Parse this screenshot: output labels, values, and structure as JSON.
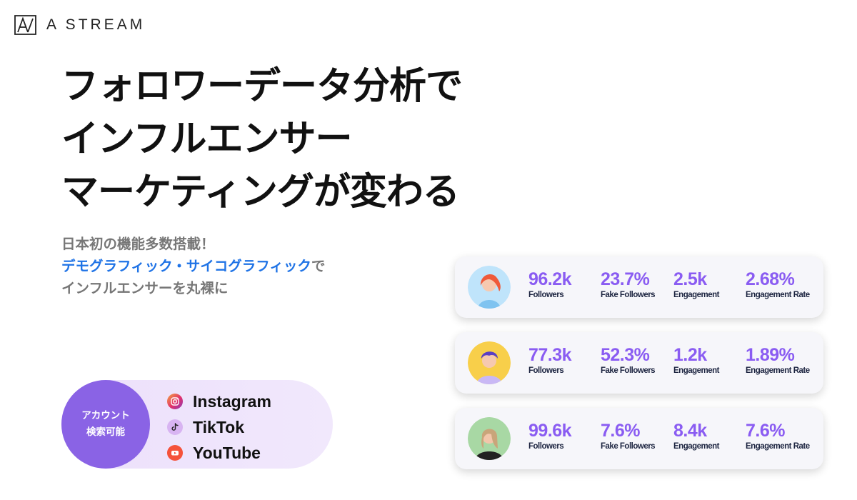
{
  "brand": {
    "name": "A STREAM",
    "icon": "a-stream-logo-icon"
  },
  "headline": {
    "line1": "フォロワーデータ分析で",
    "line2": "インフルエンサー",
    "line3": "マーケティングが変わる"
  },
  "sub": {
    "line1": "日本初の機能多数搭載！",
    "line2_highlight": "デモグラフィック・サイコグラフィック",
    "line2_rest": "で",
    "line3": "インフルエンサーを丸裸に"
  },
  "accounts": {
    "badge_line1": "アカウント",
    "badge_line2": "検索可能",
    "platforms": [
      {
        "label": "Instagram",
        "icon": "instagram-icon"
      },
      {
        "label": "TikTok",
        "icon": "tiktok-icon"
      },
      {
        "label": "YouTube",
        "icon": "youtube-icon"
      }
    ]
  },
  "stat_labels": {
    "followers": "Followers",
    "fake_followers": "Fake Followers",
    "engagement": "Engagement",
    "engagement_rate": "Engagement Rate"
  },
  "profiles": [
    {
      "avatar": "red-hair-woman-avatar",
      "followers": "96.2k",
      "fake_followers": "23.7%",
      "engagement": "2.5k",
      "engagement_rate": "2.68%"
    },
    {
      "avatar": "purple-hair-man-avatar",
      "followers": "77.3k",
      "fake_followers": "52.3%",
      "engagement": "1.2k",
      "engagement_rate": "1.89%"
    },
    {
      "avatar": "blonde-woman-avatar",
      "followers": "99.6k",
      "fake_followers": "7.6%",
      "engagement": "8.4k",
      "engagement_rate": "7.6%"
    }
  ],
  "colors": {
    "accent_purple": "#8a5cf2",
    "highlight_blue": "#1f73e6",
    "pill_circle": "#8a63e5",
    "pill_bg": "#ece0fb"
  }
}
